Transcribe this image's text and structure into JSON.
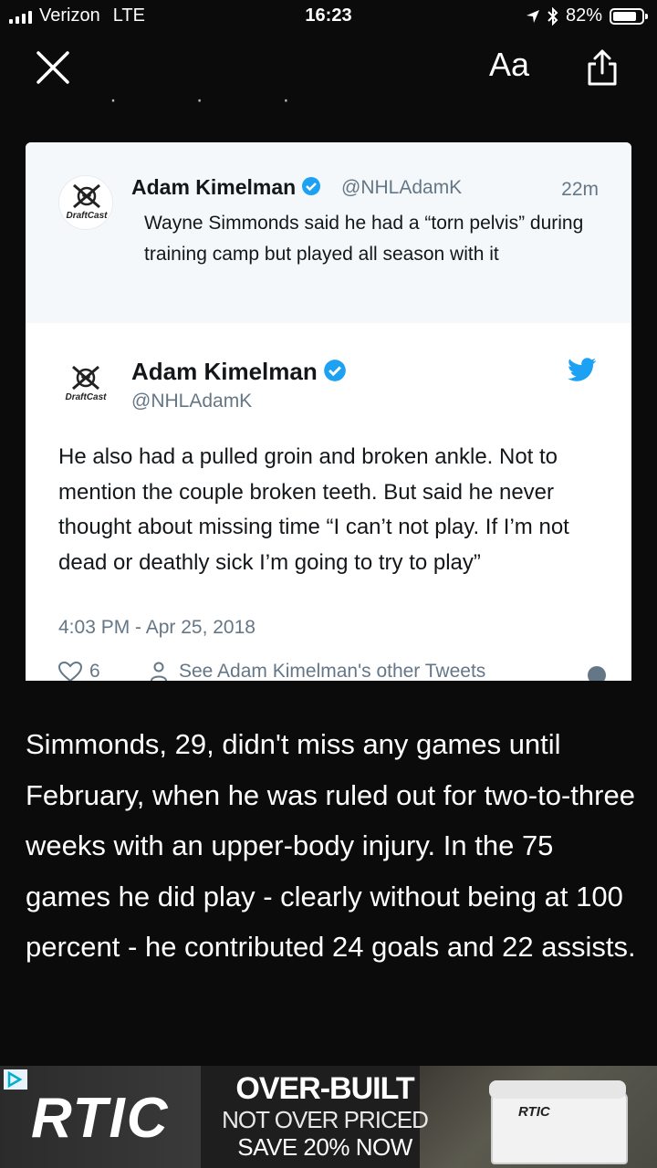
{
  "status_bar": {
    "carrier": "Verizon",
    "network": "LTE",
    "time": "16:23",
    "battery_percent": "82%",
    "battery_level": 0.82
  },
  "nav": {
    "font_button_label": "Aa"
  },
  "embedded_tweet": {
    "quoted": {
      "author_name": "Adam Kimelman",
      "author_handle": "@NHLAdamK",
      "time_ago": "22m",
      "text": "Wayne Simmonds said he had a “torn pelvis” during training camp but played all season with it",
      "avatar_label": "DraftCast"
    },
    "main": {
      "author_name": "Adam Kimelman",
      "author_handle": "@NHLAdamK",
      "avatar_label": "DraftCast",
      "text": "He also had a pulled groin and broken ankle. Not to mention the couple broken teeth. But said he never thought about missing time “I can’t not play. If I’m not dead or deathly sick I’m going to try to play”",
      "date": "4:03 PM - Apr 25, 2018",
      "like_count": "6",
      "other_tweets_label": "See Adam Kimelman's other Tweets"
    }
  },
  "article": {
    "paragraph": "Simmonds, 29, didn't miss any games until February, when he was ruled out for two-to-three weeks with an upper-body injury. In the 75 games he did play - clearly without being at 100 percent - he contributed 24 goals and 22 assists."
  },
  "ad": {
    "brand": "RTIC",
    "line1": "OVER-BUILT",
    "line2": "NOT OVER PRICED",
    "line3": "SAVE 20% NOW",
    "product_brand": "RTIC"
  },
  "colors": {
    "twitter_blue": "#1da1f2",
    "muted_text": "#657786",
    "page_background": "#0b0b0b"
  }
}
